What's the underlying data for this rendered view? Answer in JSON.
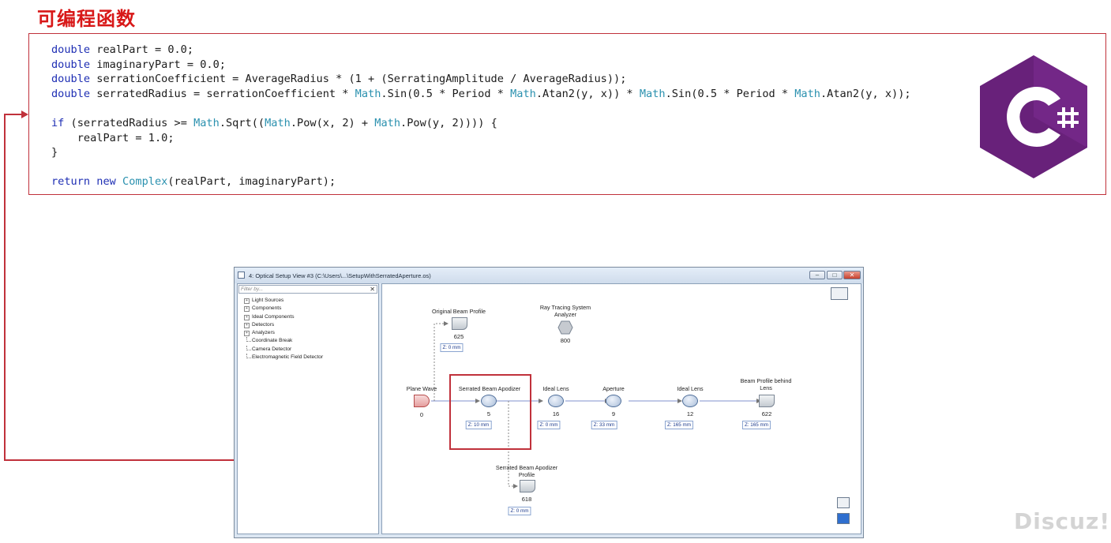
{
  "heading": "可编程函数",
  "code_lines": [
    "double realPart = 0.0;",
    "double imaginaryPart = 0.0;",
    "double serrationCoefficient = AverageRadius * (1 + (SerratingAmplitude / AverageRadius));",
    "double serratedRadius = serrationCoefficient * Math.Sin(0.5 * Period * Math.Atan2(y, x)) * Math.Sin(0.5 * Period * Math.Atan2(y, x));",
    "",
    "if (serratedRadius >= Math.Sqrt((Math.Pow(x, 2) + Math.Pow(y, 2)))) {",
    "    realPart = 1.0;",
    "}",
    "",
    "return new Complex(realPart, imaginaryPart);"
  ],
  "logo": {
    "icon": "csharp-logo-icon",
    "text": "C#",
    "color": "#68217a"
  },
  "window": {
    "title": "4: Optical Setup View #3 (C:\\Users\\...\\SetupWithSerratedAperture.os)",
    "filter_placeholder": "Filter by...",
    "tree_items": [
      {
        "label": "Light Sources",
        "expandable": true
      },
      {
        "label": "Components",
        "expandable": true
      },
      {
        "label": "Ideal Components",
        "expandable": true
      },
      {
        "label": "Detectors",
        "expandable": true
      },
      {
        "label": "Analyzers",
        "expandable": true
      },
      {
        "label": "Coordinate Break",
        "expandable": false
      },
      {
        "label": "Camera Detector",
        "expandable": false
      },
      {
        "label": "Electromagnetic Field Detector",
        "expandable": false
      }
    ]
  },
  "nodes": {
    "original_profile": {
      "label": "Original Beam Profile",
      "id": "625",
      "z": "Z: 0 mm"
    },
    "ray_tracing": {
      "label": "Ray Tracing System Analyzer",
      "id": "800"
    },
    "plane_wave": {
      "label": "Plane Wave",
      "id": "0"
    },
    "apodizer": {
      "label": "Serrated Beam Apodizer",
      "id": "5",
      "z": "Z: 10 mm"
    },
    "ideal_lens_1": {
      "label": "Ideal Lens",
      "id": "16",
      "z": "Z: 0 mm"
    },
    "aperture": {
      "label": "Aperture",
      "id": "9",
      "z": "Z: 33 mm"
    },
    "ideal_lens_2": {
      "label": "Ideal Lens",
      "id": "12",
      "z": "Z: 165 mm"
    },
    "profile_behind": {
      "label": "Beam Profile behind Lens",
      "id": "622",
      "z": "Z: 165 mm"
    },
    "apodizer_profile": {
      "label": "Serrated Beam Apodizer Profile",
      "id": "618",
      "z": "Z: 0 mm"
    }
  },
  "watermark": "Discuz!"
}
